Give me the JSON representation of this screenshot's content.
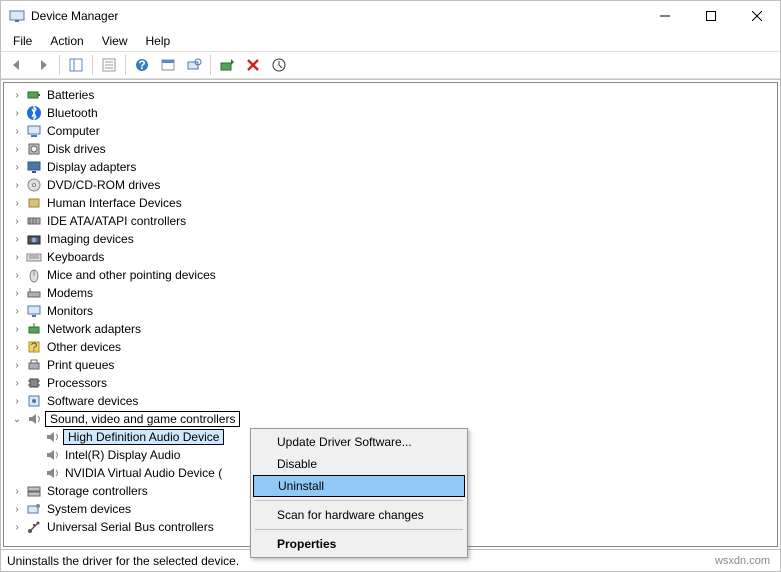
{
  "window": {
    "title": "Device Manager"
  },
  "menubar": [
    "File",
    "Action",
    "View",
    "Help"
  ],
  "toolbar_icons": [
    "back-icon",
    "forward-icon",
    "show-hide-tree-icon",
    "properties-icon",
    "help-icon",
    "show-hidden-icon",
    "scan-hardware-icon",
    "update-driver-icon",
    "uninstall-icon",
    "add-legacy-icon"
  ],
  "tree": [
    {
      "label": "Batteries",
      "icon": "battery"
    },
    {
      "label": "Bluetooth",
      "icon": "bluetooth"
    },
    {
      "label": "Computer",
      "icon": "computer"
    },
    {
      "label": "Disk drives",
      "icon": "disk"
    },
    {
      "label": "Display adapters",
      "icon": "display"
    },
    {
      "label": "DVD/CD-ROM drives",
      "icon": "dvd"
    },
    {
      "label": "Human Interface Devices",
      "icon": "hid"
    },
    {
      "label": "IDE ATA/ATAPI controllers",
      "icon": "ide"
    },
    {
      "label": "Imaging devices",
      "icon": "imaging"
    },
    {
      "label": "Keyboards",
      "icon": "keyboard"
    },
    {
      "label": "Mice and other pointing devices",
      "icon": "mouse"
    },
    {
      "label": "Modems",
      "icon": "modem"
    },
    {
      "label": "Monitors",
      "icon": "monitor"
    },
    {
      "label": "Network adapters",
      "icon": "network"
    },
    {
      "label": "Other devices",
      "icon": "other"
    },
    {
      "label": "Print queues",
      "icon": "printer"
    },
    {
      "label": "Processors",
      "icon": "cpu"
    },
    {
      "label": "Software devices",
      "icon": "software"
    },
    {
      "label": "Sound, video and game controllers",
      "icon": "sound",
      "expanded": true,
      "framed": true,
      "children": [
        {
          "label": "High Definition Audio Device",
          "icon": "speaker",
          "selected": true
        },
        {
          "label": "Intel(R) Display Audio",
          "icon": "speaker"
        },
        {
          "label": "NVIDIA Virtual Audio Device (",
          "icon": "speaker"
        }
      ]
    },
    {
      "label": "Storage controllers",
      "icon": "storage"
    },
    {
      "label": "System devices",
      "icon": "system"
    },
    {
      "label": "Universal Serial Bus controllers",
      "icon": "usb"
    }
  ],
  "context_menu": {
    "items": [
      {
        "label": "Update Driver Software..."
      },
      {
        "label": "Disable"
      },
      {
        "label": "Uninstall",
        "selected": true
      },
      {
        "sep": true
      },
      {
        "label": "Scan for hardware changes"
      },
      {
        "sep": true
      },
      {
        "label": "Properties",
        "bold": true
      }
    ]
  },
  "status": {
    "text": "Uninstalls the driver for the selected device.",
    "watermark": "wsxdn.com"
  }
}
